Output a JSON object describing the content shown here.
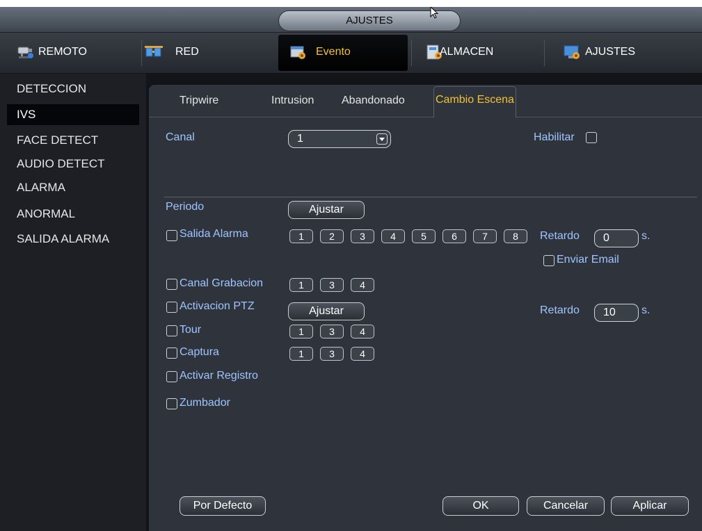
{
  "window": {
    "title": "AJUSTES"
  },
  "nav": [
    {
      "label": "REMOTO",
      "icon": "camera-icon"
    },
    {
      "label": "RED",
      "icon": "network-icon"
    },
    {
      "label": "Evento",
      "icon": "event-icon"
    },
    {
      "label": "ALMACEN",
      "icon": "storage-icon"
    },
    {
      "label": "AJUSTES",
      "icon": "monitor-settings-icon"
    }
  ],
  "sidebar": {
    "items": [
      "DETECCION",
      "IVS",
      "FACE DETECT",
      "AUDIO DETECT",
      "ALARMA",
      "ANORMAL",
      "SALIDA ALARMA"
    ],
    "active": "IVS"
  },
  "tabs": [
    "Tripwire",
    "Intrusion",
    "Abandonado",
    "Cambio Escena"
  ],
  "form": {
    "canal_label": "Canal",
    "canal_value": "1",
    "habilitar_label": "Habilitar",
    "periodo_label": "Periodo",
    "ajustar_label": "Ajustar",
    "salida_alarma_label": "Salida Alarma",
    "salida_buttons": [
      "1",
      "2",
      "3",
      "4",
      "5",
      "6",
      "7",
      "8"
    ],
    "retardo_label": "Retardo",
    "retardo_value": "0",
    "seconds_unit": "s.",
    "enviar_email_label": "Enviar Email",
    "canal_grabacion_label": "Canal Grabacion",
    "canal_grabacion_buttons": [
      "1",
      "3",
      "4"
    ],
    "activacion_ptz_label": "Activacion PTZ",
    "retardo2_value": "10",
    "tour_label": "Tour",
    "tour_buttons": [
      "1",
      "3",
      "4"
    ],
    "captura_label": "Captura",
    "captura_buttons": [
      "1",
      "3",
      "4"
    ],
    "activar_registro_label": "Activar Registro",
    "zumbador_label": "Zumbador"
  },
  "footer": {
    "default": "Por Defecto",
    "ok": "OK",
    "cancel": "Cancelar",
    "apply": "Aplicar"
  }
}
